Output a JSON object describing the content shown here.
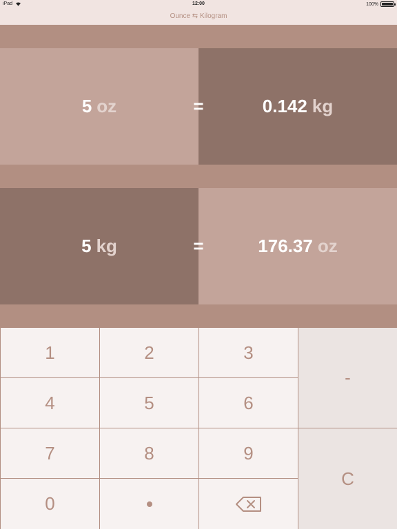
{
  "status_bar": {
    "device": "iPad",
    "time": "12:00",
    "battery": "100%",
    "battery_level": 1.0
  },
  "nav": {
    "title": "Ounce ⇆ Kilogram"
  },
  "conversions": [
    {
      "input_value": "5",
      "input_unit": "oz",
      "equals": "=",
      "output_value": "0.142",
      "output_unit": "kg"
    },
    {
      "input_value": "5",
      "input_unit": "kg",
      "equals": "=",
      "output_value": "176.37",
      "output_unit": "oz"
    }
  ],
  "keypad": {
    "k1": "1",
    "k2": "2",
    "k3": "3",
    "k4": "4",
    "k5": "5",
    "k6": "6",
    "k7": "7",
    "k8": "8",
    "k9": "9",
    "k0": "0",
    "decimal_icon": "decimal-point-icon",
    "backspace_icon": "backspace-icon",
    "minus": "-",
    "clear": "C"
  },
  "colors": {
    "accent": "#b48f82",
    "band": "#b28f82",
    "light_cell": "#c3a49a",
    "dark_cell": "#8e7268",
    "key": "#f7f2f1",
    "side_key": "#ebe4e2"
  }
}
